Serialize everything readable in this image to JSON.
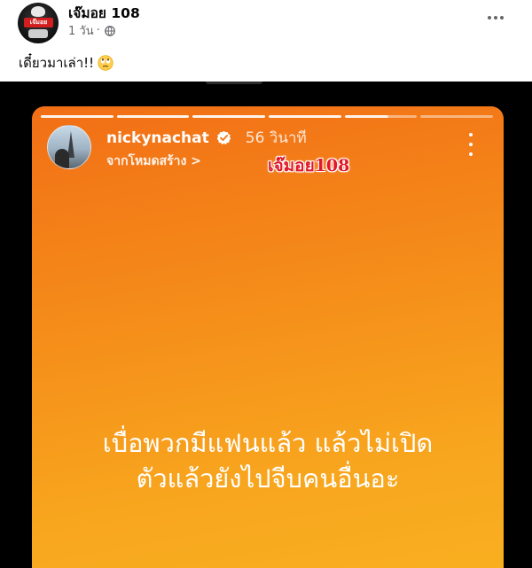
{
  "post": {
    "author_name": "เจ๊มอย 108",
    "avatar_text": "เจ๊มอย",
    "time": "1 วัน",
    "separator": "·",
    "audience_icon": "globe-icon",
    "more_icon": "more-horizontal-icon",
    "caption": "เดี๋ยวมาเล่า!!",
    "caption_emoji_icon": "face-with-rolling-eyes-icon"
  },
  "story": {
    "username": "nickynachat",
    "verified_icon": "verified-badge-icon",
    "time": "56 วินาที",
    "subtitle": "จากโหมดสร้าง >",
    "watermark": "เจ๊มอย108",
    "more_icon": "more-vertical-icon",
    "progress": {
      "segments": 6,
      "completed": 4
    },
    "text_lines": [
      "เบื่อพวกมีแฟนแล้ว แล้วไม่เปิด",
      "ตัวแล้วยังไปจีบคนอื่นอะ"
    ],
    "colors": {
      "gradient_top": "#f26e16",
      "gradient_bottom": "#f9b020",
      "watermark": "#e0182a"
    }
  }
}
